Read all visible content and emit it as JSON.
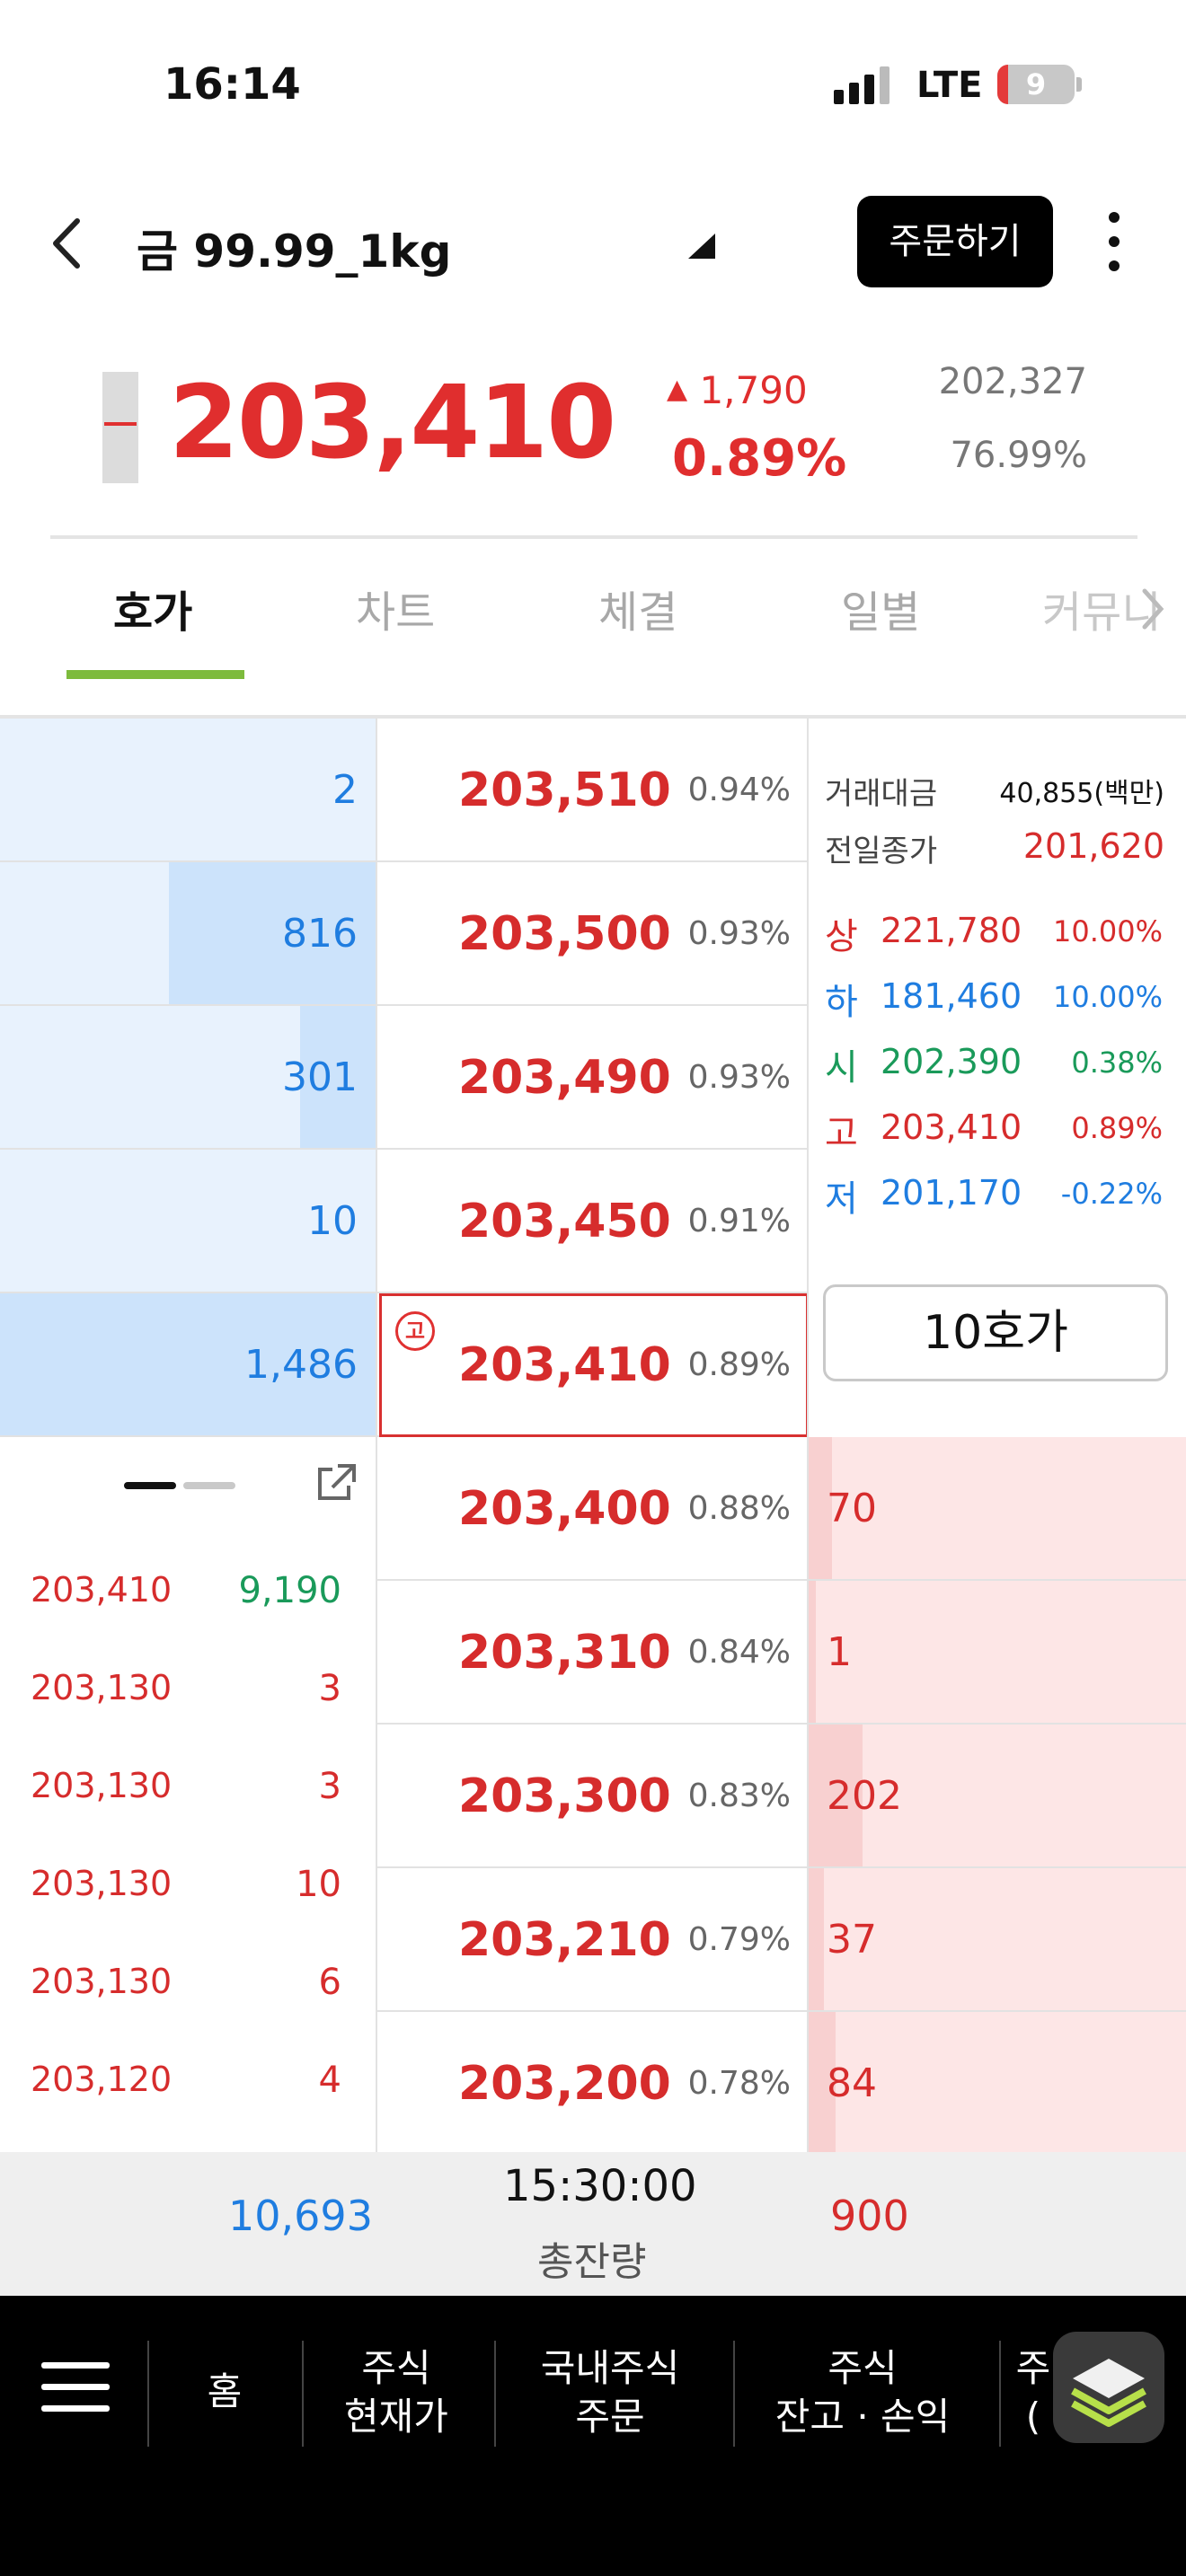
{
  "status_bar": {
    "time": "16:14",
    "network": "LTE",
    "battery": "9"
  },
  "header": {
    "title": "금 99.99_1kg",
    "order_button": "주문하기"
  },
  "price": {
    "current": "203,410",
    "change": "1,790",
    "change_pct": "0.89%",
    "ref_value": "202,327",
    "ref_pct": "76.99%"
  },
  "tabs": [
    {
      "label": "호가"
    },
    {
      "label": "차트"
    },
    {
      "label": "체결"
    },
    {
      "label": "일별"
    },
    {
      "label": "커뮤니"
    }
  ],
  "asks": [
    {
      "qty": "2",
      "price": "203,510",
      "pct": "0.94%",
      "level": 0.0
    },
    {
      "qty": "816",
      "price": "203,500",
      "pct": "0.93%",
      "level": 0.55
    },
    {
      "qty": "301",
      "price": "203,490",
      "pct": "0.93%",
      "level": 0.2
    },
    {
      "qty": "10",
      "price": "203,450",
      "pct": "0.91%",
      "level": 0.0
    },
    {
      "qty": "1,486",
      "price": "203,410",
      "pct": "0.89%",
      "level": 1.0
    }
  ],
  "bids": [
    {
      "qty": "70",
      "price": "203,400",
      "pct": "0.88%",
      "level": 0.35
    },
    {
      "qty": "1",
      "price": "203,310",
      "pct": "0.84%",
      "level": 0.0
    },
    {
      "qty": "202",
      "price": "203,300",
      "pct": "0.83%",
      "level": 1.0
    },
    {
      "qty": "37",
      "price": "203,210",
      "pct": "0.79%",
      "level": 0.18
    },
    {
      "qty": "84",
      "price": "203,200",
      "pct": "0.78%",
      "level": 0.42
    }
  ],
  "current_badge": "고",
  "info": {
    "trade_amount_label": "거래대금",
    "trade_amount_value": "40,855(백만)",
    "prev_close_label": "전일종가",
    "prev_close_value": "201,620",
    "hilo": [
      {
        "label": "상",
        "price": "221,780",
        "pct": "10.00%",
        "color": "#d62c2c"
      },
      {
        "label": "하",
        "price": "181,460",
        "pct": "10.00%",
        "color": "#1f7de0"
      },
      {
        "label": "시",
        "price": "202,390",
        "pct": "0.38%",
        "color": "#1a9a5a"
      },
      {
        "label": "고",
        "price": "203,410",
        "pct": "0.89%",
        "color": "#d62c2c"
      },
      {
        "label": "저",
        "price": "201,170",
        "pct": "-0.22%",
        "color": "#1f7de0"
      }
    ],
    "hoga_button": "10호가"
  },
  "executions": [
    {
      "price": "203,410",
      "qty": "9,190"
    },
    {
      "price": "203,130",
      "qty": "3"
    },
    {
      "price": "203,130",
      "qty": "3"
    },
    {
      "price": "203,130",
      "qty": "10"
    },
    {
      "price": "203,130",
      "qty": "6"
    },
    {
      "price": "203,120",
      "qty": "4"
    }
  ],
  "totals": {
    "ask_total": "10,693",
    "time": "15:30:00",
    "label": "총잔량",
    "bid_total": "900"
  },
  "bottom_nav": [
    {
      "line1": "홈",
      "line2": ""
    },
    {
      "line1": "주식",
      "line2": "현재가"
    },
    {
      "line1": "국내주식",
      "line2": "주문"
    },
    {
      "line1": "주식",
      "line2": "잔고 · 손익"
    },
    {
      "line1": "주",
      "line2": "("
    }
  ]
}
